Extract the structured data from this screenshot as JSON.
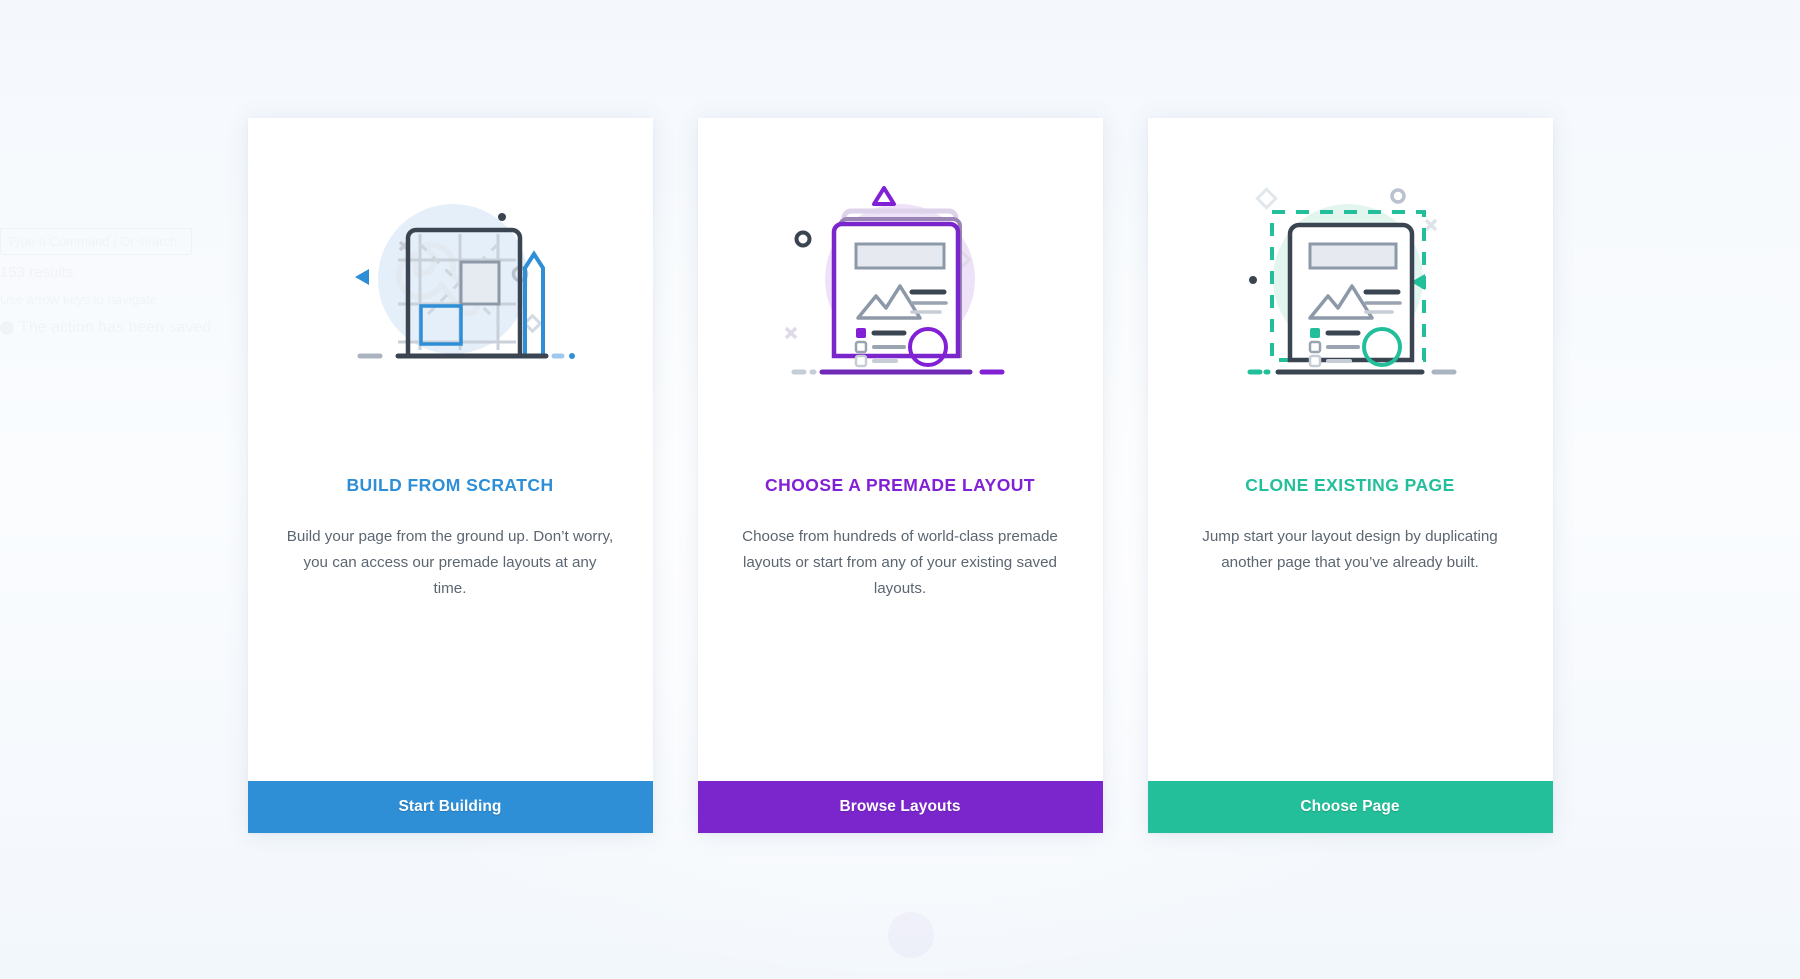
{
  "background": {
    "ghost": {
      "search_placeholder": "Type a Command | Or search",
      "results_count": "153 results",
      "hint": "Use arrow keys to navigate",
      "status": "The action has been saved"
    }
  },
  "cards": [
    {
      "id": "build-from-scratch",
      "title": "BUILD FROM SCRATCH",
      "description": "Build your page from the ground up. Don’t worry, you can access our premade layouts at any time.",
      "button_label": "Start Building",
      "accent": "#2e8ed6",
      "illustration": "blueprint-grid-icon"
    },
    {
      "id": "choose-a-premade-layout",
      "title": "CHOOSE A PREMADE LAYOUT",
      "description": "Choose from hundreds of world-class premade layouts or start from any of your existing saved layouts.",
      "button_label": "Browse Layouts",
      "accent": "#7b26cc",
      "illustration": "stacked-pages-icon"
    },
    {
      "id": "clone-existing-page",
      "title": "CLONE EXISTING PAGE",
      "description": "Jump start your layout design by duplicating another page that you’ve already built.",
      "button_label": "Choose Page",
      "accent": "#23bf9a",
      "illustration": "duplicate-page-icon"
    }
  ]
}
